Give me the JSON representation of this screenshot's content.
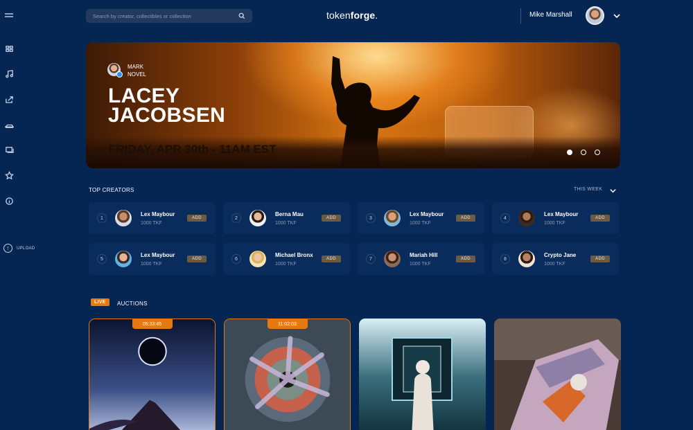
{
  "header": {
    "search_placeholder": "Search by creator, collectibles or collection",
    "brand_light": "token",
    "brand_bold": "forge",
    "brand_dot": ".",
    "user_name": "Mike Marshall"
  },
  "sidebar": {
    "upload_label": "UPLOAD"
  },
  "hero": {
    "author_line1": "MARK",
    "author_line2": "NOVEL",
    "title_line1": "LACEY",
    "title_line2": "JACOBSEN",
    "date": "FRIDAY, APR 30th - 11AM EST",
    "active_slide": 1,
    "slide_count": 3
  },
  "top_creators": {
    "title": "TOP CREATORS",
    "filter": "THIS WEEK",
    "creators": [
      {
        "rank": "1",
        "name": "Lex Maybour",
        "tkf": "1000 TKF",
        "action": "ADD"
      },
      {
        "rank": "2",
        "name": "Berna Mau",
        "tkf": "1000 TKF",
        "action": "ADD"
      },
      {
        "rank": "3",
        "name": "Lex Maybour",
        "tkf": "1000 TKF",
        "action": "ADD"
      },
      {
        "rank": "4",
        "name": "Lex Maybour",
        "tkf": "1000 TKF",
        "action": "ADD"
      },
      {
        "rank": "5",
        "name": "Lex Maybour",
        "tkf": "1000 TKF",
        "action": "ADD"
      },
      {
        "rank": "6",
        "name": "Michael Bronx",
        "tkf": "1000 TKF",
        "action": "ADD"
      },
      {
        "rank": "7",
        "name": "Mariah Hill",
        "tkf": "1000 TKF",
        "action": "ADD"
      },
      {
        "rank": "8",
        "name": "Crypto Jane",
        "tkf": "1000 TKF",
        "action": "ADD"
      }
    ]
  },
  "auctions": {
    "live_label": "LIVE",
    "title": "AUCTIONS",
    "items": [
      {
        "timer": "05:33:45"
      },
      {
        "timer": "11:02:03"
      },
      {
        "timer": ""
      },
      {
        "timer": ""
      }
    ]
  },
  "colors": {
    "background": "#052553",
    "card": "#0a2c5c",
    "accent": "#e8790f"
  }
}
